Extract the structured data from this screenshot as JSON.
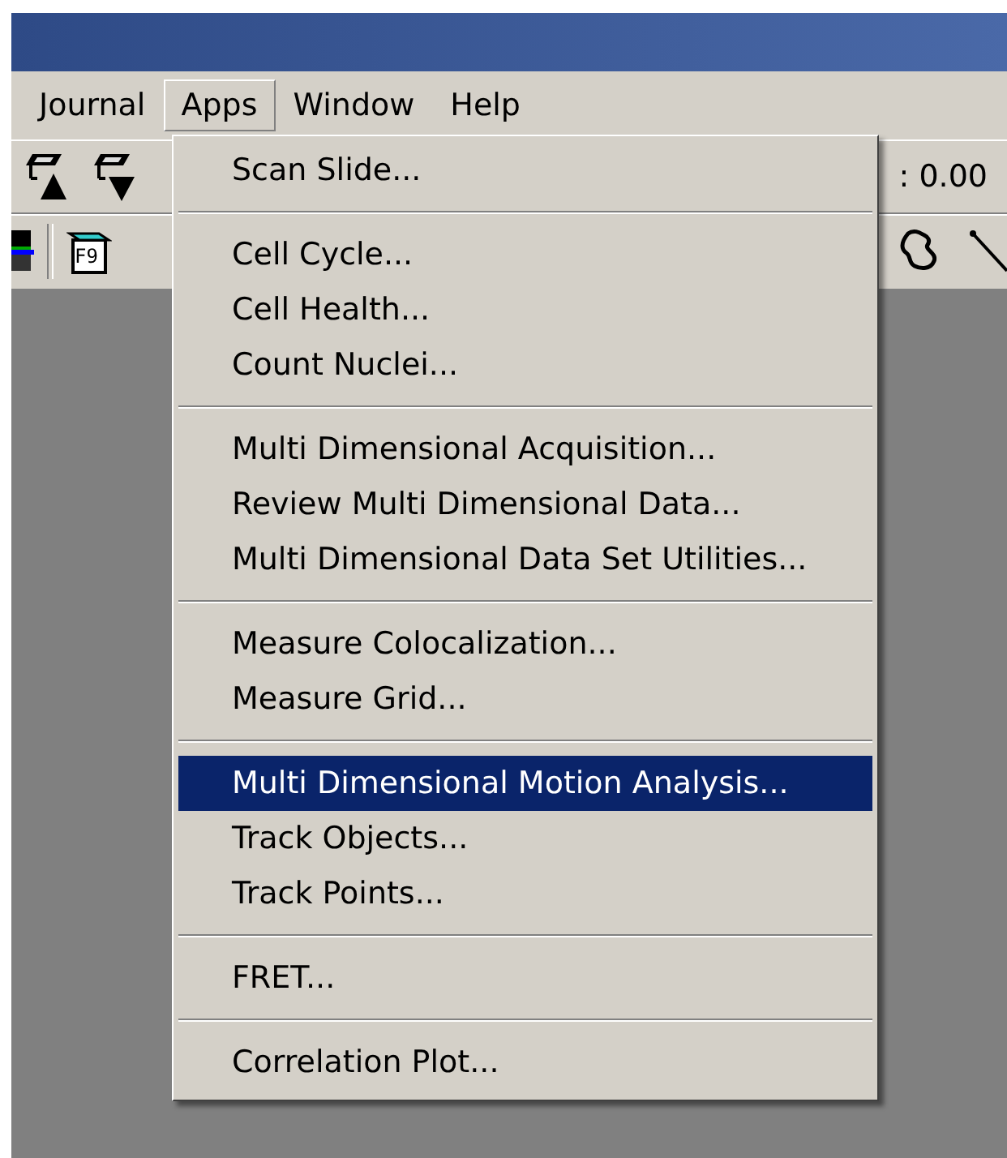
{
  "menu_bar": [
    {
      "label": "Journal",
      "selected": false
    },
    {
      "label": "Apps",
      "selected": true
    },
    {
      "label": "Window",
      "selected": false
    },
    {
      "label": "Help",
      "selected": false
    }
  ],
  "toolbar": {
    "reading": ": 0.00",
    "f9_key": "F9"
  },
  "apps_menu": [
    [
      {
        "label": "Scan Slide...",
        "selected": false
      }
    ],
    [
      {
        "label": "Cell Cycle...",
        "selected": false
      },
      {
        "label": "Cell Health...",
        "selected": false
      },
      {
        "label": "Count Nuclei...",
        "selected": false
      }
    ],
    [
      {
        "label": "Multi Dimensional Acquisition...",
        "selected": false
      },
      {
        "label": "Review Multi Dimensional Data...",
        "selected": false
      },
      {
        "label": "Multi Dimensional Data Set Utilities...",
        "selected": false
      }
    ],
    [
      {
        "label": "Measure Colocalization...",
        "selected": false
      },
      {
        "label": "Measure Grid...",
        "selected": false
      }
    ],
    [
      {
        "label": "Multi Dimensional Motion Analysis...",
        "selected": true
      },
      {
        "label": "Track Objects...",
        "selected": false
      },
      {
        "label": "Track Points...",
        "selected": false
      }
    ],
    [
      {
        "label": "FRET...",
        "selected": false
      }
    ],
    [
      {
        "label": "Correlation Plot...",
        "selected": false
      }
    ]
  ]
}
